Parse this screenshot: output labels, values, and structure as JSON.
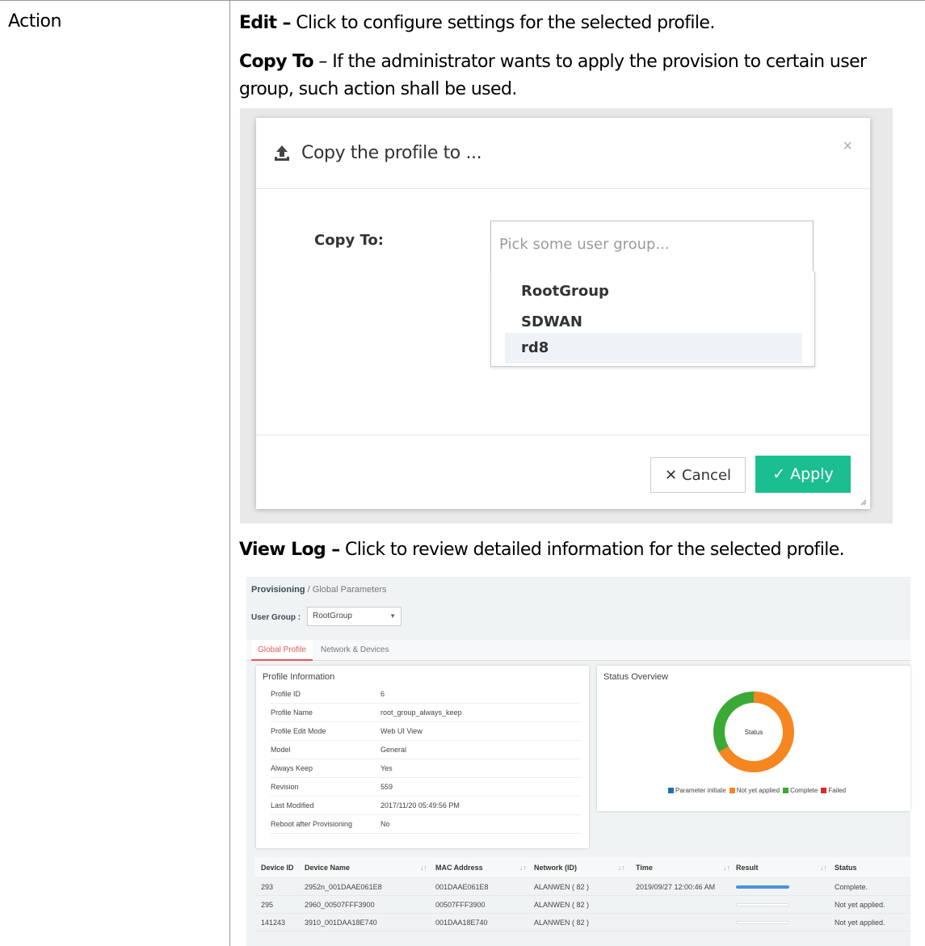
{
  "table": {
    "head_label": "Action"
  },
  "paragraphs": {
    "edit_term": "Edit –",
    "edit_text": " Click to configure settings for the selected profile.",
    "copy_term": "Copy To",
    "copy_text": " – If the administrator wants to apply the provision to certain user group, such action shall be used.",
    "viewlog_term": "View Log –",
    "viewlog_text": " Click to review detailed information for the selected profile."
  },
  "dialog": {
    "title": "Copy the profile to ...",
    "close_glyph": "×",
    "copy_label": "Copy To:",
    "input_placeholder": "Pick some user group...",
    "options": [
      "RootGroup",
      "SDWAN",
      "rd8"
    ],
    "highlighted_option": "rd8",
    "cancel_glyph": "✕",
    "cancel_label": "Cancel",
    "apply_glyph": "✓",
    "apply_label": "Apply",
    "apply_color": "#1bbf8f"
  },
  "log": {
    "breadcrumb_root": "Provisioning",
    "breadcrumb_sep": " / ",
    "breadcrumb_page": "Global Parameters",
    "user_group_label": "User Group :",
    "user_group_value": "RootGroup",
    "tabs": [
      "Global Profile",
      "Network & Devices"
    ],
    "active_tab": "Global Profile",
    "profile_panel_title": "Profile Information",
    "profile_info": [
      {
        "key": "Profile ID",
        "value": "6"
      },
      {
        "key": "Profile Name",
        "value": "root_group_always_keep"
      },
      {
        "key": "Profile Edit Mode",
        "value": "Web UI View"
      },
      {
        "key": "Model",
        "value": "General"
      },
      {
        "key": "Always Keep",
        "value": "Yes"
      },
      {
        "key": "Revision",
        "value": "559"
      },
      {
        "key": "Last Modified",
        "value": "2017/11/20 05:49:56 PM"
      },
      {
        "key": "Reboot after Provisioning",
        "value": "No"
      }
    ],
    "status_panel_title": "Status Overview",
    "donut_center_label": "Status",
    "legend": [
      {
        "label": "Parameter initiate",
        "color": "#1f6fb5"
      },
      {
        "label": "Not yet applied",
        "color": "#f6861f"
      },
      {
        "label": "Complete",
        "color": "#3aa935"
      },
      {
        "label": "Failed",
        "color": "#d9292b"
      }
    ],
    "table_headers": [
      "Device ID",
      "Device Name",
      "MAC Address",
      "Network (ID)",
      "Time",
      "Result",
      "Status"
    ],
    "rows": [
      {
        "device_id": "293",
        "device_name": "2952n_001DAAE061E8",
        "mac": "001DAAE061E8",
        "network": "ALANWEN ( 82 )",
        "time": "2019/09/27 12:00:46 AM",
        "result_progress": 1.0,
        "status": "Complete."
      },
      {
        "device_id": "295",
        "device_name": "2960_00507FFF3900",
        "mac": "00507FFF3900",
        "network": "ALANWEN ( 82 )",
        "time": "",
        "result_progress": 0.0,
        "status": "Not yet applied."
      },
      {
        "device_id": "141243",
        "device_name": "3910_001DAA18E740",
        "mac": "001DAA18E740",
        "network": "ALANWEN ( 82 )",
        "time": "",
        "result_progress": 0.0,
        "status": "Not yet applied."
      }
    ]
  },
  "chart_data": {
    "type": "pie",
    "title": "Status Overview",
    "categories": [
      "Parameter initiate",
      "Not yet applied",
      "Complete",
      "Failed"
    ],
    "values": [
      0,
      2,
      1,
      0
    ],
    "colors": [
      "#1f6fb5",
      "#f6861f",
      "#3aa935",
      "#d9292b"
    ],
    "legend_position": "bottom"
  }
}
